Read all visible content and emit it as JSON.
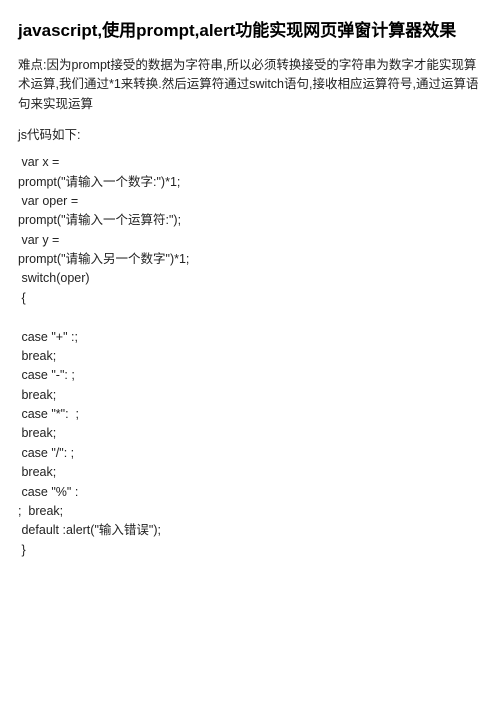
{
  "title": "javascript,使用prompt,alert功能实现网页弹窗计算器效果",
  "difficulty": "难点:因为prompt接受的数据为字符串,所以必须转换接受的字符串为数字才能实现算术运算,我们通过*1来转换.然后运算符通过switch语句,接收相应运算符号,通过运算语句来实现运算",
  "subhead": "js代码如下:",
  "code": " var x =\nprompt(\"请输入一个数字:\")*1;\n var oper =\nprompt(\"请输入一个运算符:\");\n var y =\nprompt(\"请输入另一个数字\")*1;\n switch(oper)\n {\n\n case \"+\" :;\n break;\n case \"-\": ;\n break;\n case \"*\":  ;\n break;\n case \"/\": ;\n break;\n case \"%\" :\n;  break;\n default :alert(\"输入错误\");\n }"
}
